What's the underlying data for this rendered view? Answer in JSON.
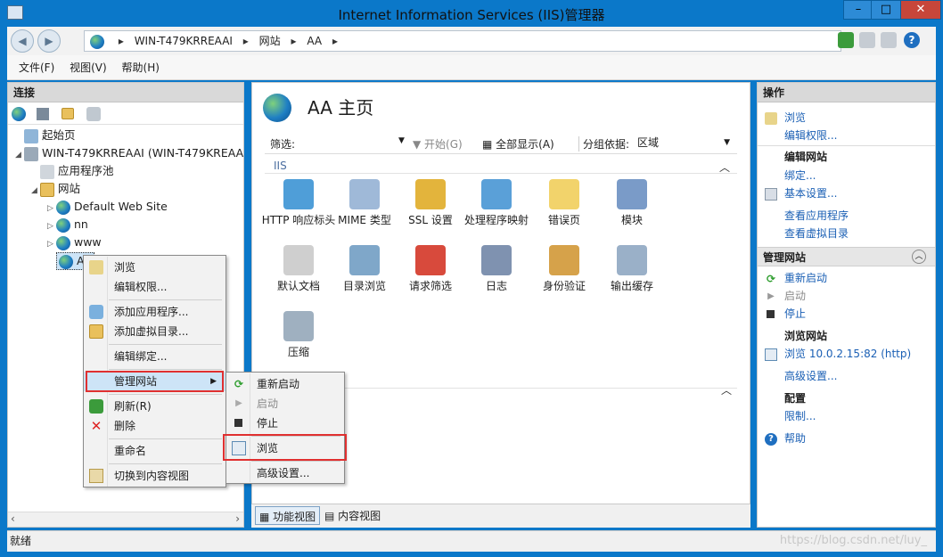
{
  "window": {
    "title": "Internet Information Services (IIS)管理器",
    "controls": [
      "–",
      "□",
      "✕"
    ]
  },
  "address": {
    "crumbs": [
      "WIN-T479KRREAAI",
      "网站",
      "AA"
    ],
    "sep": "▸"
  },
  "menubar": [
    "文件(F)",
    "视图(V)",
    "帮助(H)"
  ],
  "connections": {
    "title": "连接",
    "tree": [
      {
        "label": "起始页",
        "icon": "start-page-icon"
      },
      {
        "label": "WIN-T479KRREAAI (WIN-T479KREAA",
        "icon": "server-icon"
      },
      {
        "label": "应用程序池",
        "icon": "app-pool-icon"
      },
      {
        "label": "网站",
        "icon": "sites-folder-icon"
      },
      {
        "label": "Default Web Site",
        "icon": "globe-icon"
      },
      {
        "label": "nn",
        "icon": "globe-icon"
      },
      {
        "label": "www",
        "icon": "globe-icon"
      },
      {
        "label": "AA",
        "icon": "globe-icon"
      }
    ]
  },
  "center": {
    "title": "AA 主页",
    "filter_label": "筛选:",
    "start_label": "开始(G)",
    "show_all_label": "全部显示(A)",
    "groupby_label": "分组依据:",
    "groupby_value": "区域",
    "section": "IIS",
    "features": [
      {
        "label": "HTTP 响应标头",
        "icon": "http-headers-icon"
      },
      {
        "label": "MIME 类型",
        "icon": "mime-types-icon"
      },
      {
        "label": "SSL 设置",
        "icon": "ssl-lock-icon"
      },
      {
        "label": "处理程序映射",
        "icon": "handler-mappings-icon"
      },
      {
        "label": "错误页",
        "icon": "error-pages-icon"
      },
      {
        "label": "模块",
        "icon": "modules-icon"
      },
      {
        "label": "默认文档",
        "icon": "default-document-icon"
      },
      {
        "label": "目录浏览",
        "icon": "directory-browsing-icon"
      },
      {
        "label": "请求筛选",
        "icon": "request-filtering-icon"
      },
      {
        "label": "日志",
        "icon": "logging-icon"
      },
      {
        "label": "身份验证",
        "icon": "authentication-icon"
      },
      {
        "label": "输出缓存",
        "icon": "output-caching-icon"
      },
      {
        "label": "压缩",
        "icon": "compression-icon"
      }
    ],
    "tabs": [
      "功能视图",
      "内容视图"
    ]
  },
  "context_menu": {
    "items": [
      "浏览",
      "编辑权限...",
      "添加应用程序...",
      "添加虚拟目录...",
      "编辑绑定...",
      "管理网站",
      "刷新(R)",
      "删除",
      "重命名",
      "切换到内容视图"
    ]
  },
  "submenu": {
    "items": [
      "重新启动",
      "启动",
      "停止",
      "浏览",
      "高级设置..."
    ]
  },
  "actions": {
    "title": "操作",
    "browse": "浏览",
    "edit_perm": "编辑权限...",
    "edit_site_hd": "编辑网站",
    "bindings": "绑定...",
    "basic_settings": "基本设置...",
    "view_apps": "查看应用程序",
    "view_vdirs": "查看虚拟目录",
    "manage_site_hd": "管理网站",
    "restart": "重新启动",
    "start": "启动",
    "stop": "停止",
    "browse_site_hd": "浏览网站",
    "browse_url": "浏览 10.0.2.15:82 (http)",
    "advanced": "高级设置...",
    "config_hd": "配置",
    "limits": "限制...",
    "help": "帮助"
  },
  "status": {
    "text": "就绪"
  },
  "watermark": "https://blog.csdn.net/luy_"
}
